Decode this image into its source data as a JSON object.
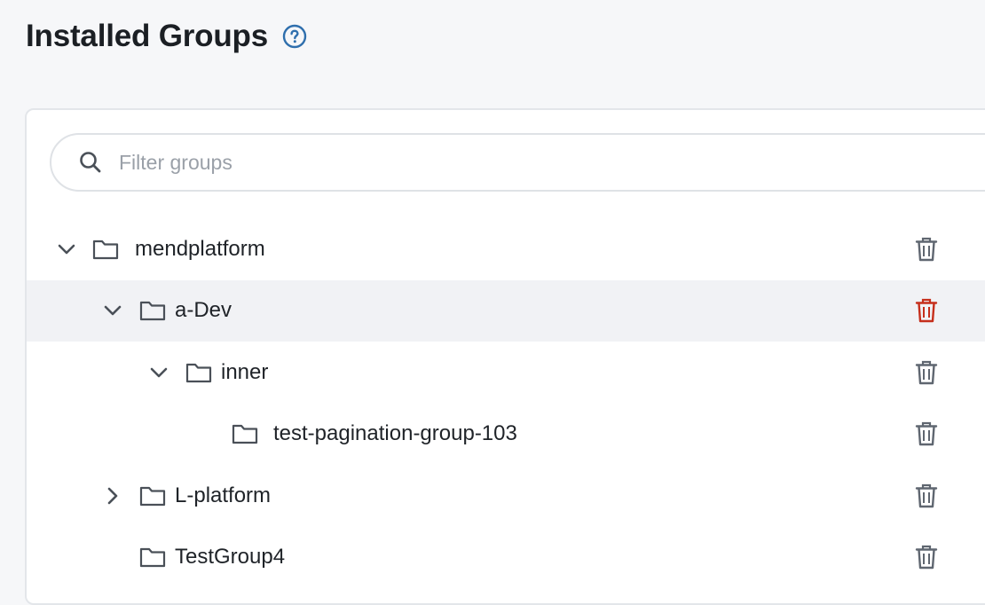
{
  "header": {
    "title": "Installed Groups",
    "help_icon": "question-circle-icon"
  },
  "search": {
    "placeholder": "Filter groups",
    "value": ""
  },
  "colors": {
    "accent": "#2f6fad",
    "trash_default": "#5f6670",
    "trash_hover": "#c62f1c",
    "row_highlight": "#f1f2f5"
  },
  "tree": [
    {
      "label": "mendplatform",
      "depth": 0,
      "expandable": true,
      "expanded": true,
      "highlighted": false
    },
    {
      "label": "a-Dev",
      "depth": 1,
      "expandable": true,
      "expanded": true,
      "highlighted": true
    },
    {
      "label": "inner",
      "depth": 2,
      "expandable": true,
      "expanded": true,
      "highlighted": false
    },
    {
      "label": "test-pagination-group-103",
      "depth": 3,
      "expandable": false,
      "expanded": false,
      "highlighted": false
    },
    {
      "label": "L-platform",
      "depth": 1,
      "expandable": true,
      "expanded": false,
      "highlighted": false
    },
    {
      "label": "TestGroup4",
      "depth": 1,
      "expandable": false,
      "expanded": false,
      "highlighted": false
    }
  ]
}
